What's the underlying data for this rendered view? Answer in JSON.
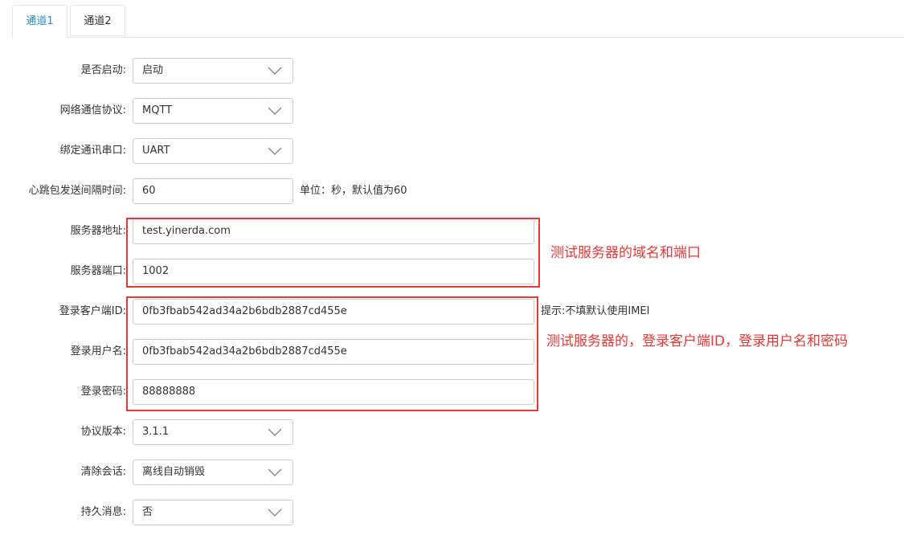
{
  "tabs": [
    {
      "label": "通道1",
      "active": true
    },
    {
      "label": "通道2",
      "active": false
    }
  ],
  "form": {
    "enable": {
      "label": "是否启动:",
      "value": "启动"
    },
    "protocol": {
      "label": "网络通信协议:",
      "value": "MQTT"
    },
    "serial": {
      "label": "绑定通讯串口:",
      "value": "UART"
    },
    "heartbeat": {
      "label": "心跳包发送间隔时间:",
      "value": "60",
      "hint": "单位：秒，默认值为60"
    },
    "server_addr": {
      "label": "服务器地址:",
      "value": "test.yinerda.com"
    },
    "server_port": {
      "label": "服务器端口:",
      "value": "1002"
    },
    "client_id": {
      "label": "登录客户端ID:",
      "value": "0fb3fbab542ad34a2b6bdb2887cd455e",
      "hint": "提示:不填默认使用IMEI"
    },
    "username": {
      "label": "登录用户名:",
      "value": "0fb3fbab542ad34a2b6bdb2887cd455e"
    },
    "password": {
      "label": "登录密码:",
      "value": "88888888"
    },
    "version": {
      "label": "协议版本:",
      "value": "3.1.1"
    },
    "clean_session": {
      "label": "清除会话:",
      "value": "离线自动销毁"
    },
    "retain": {
      "label": "持久消息:",
      "value": "否"
    }
  },
  "annotations": {
    "server": "测试服务器的域名和端口",
    "login": "测试服务器的，登录客户端ID，登录用户名和密码"
  },
  "colors": {
    "accent": "#2b8fd9",
    "annotation_red": "#e53935",
    "border": "#cccccc"
  }
}
